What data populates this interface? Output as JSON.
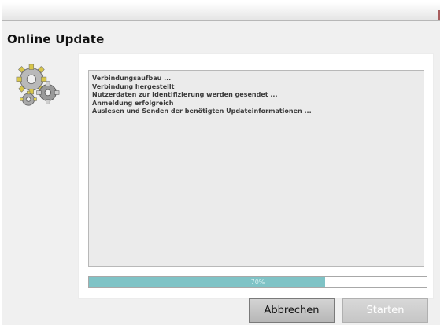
{
  "window": {
    "title": "Online Update",
    "icon": "gears-icon"
  },
  "log": {
    "lines": [
      "Verbindungsaufbau ...",
      "Verbindung hergestellt",
      "Nutzerdaten zur Identifizierung werden gesendet ...",
      "Anmeldung erfolgreich",
      "Auslesen und Senden der benötigten Updateinformationen ..."
    ]
  },
  "progress": {
    "value_percent": 70,
    "label": "70%",
    "fill_color": "#7fc3c6"
  },
  "buttons": {
    "cancel_label": "Abbrechen",
    "start_label": "Starten"
  },
  "colors": {
    "window_bg": "#f0f0f0",
    "log_bg": "#ebebeb",
    "start_disabled_text": "#ffffff"
  }
}
